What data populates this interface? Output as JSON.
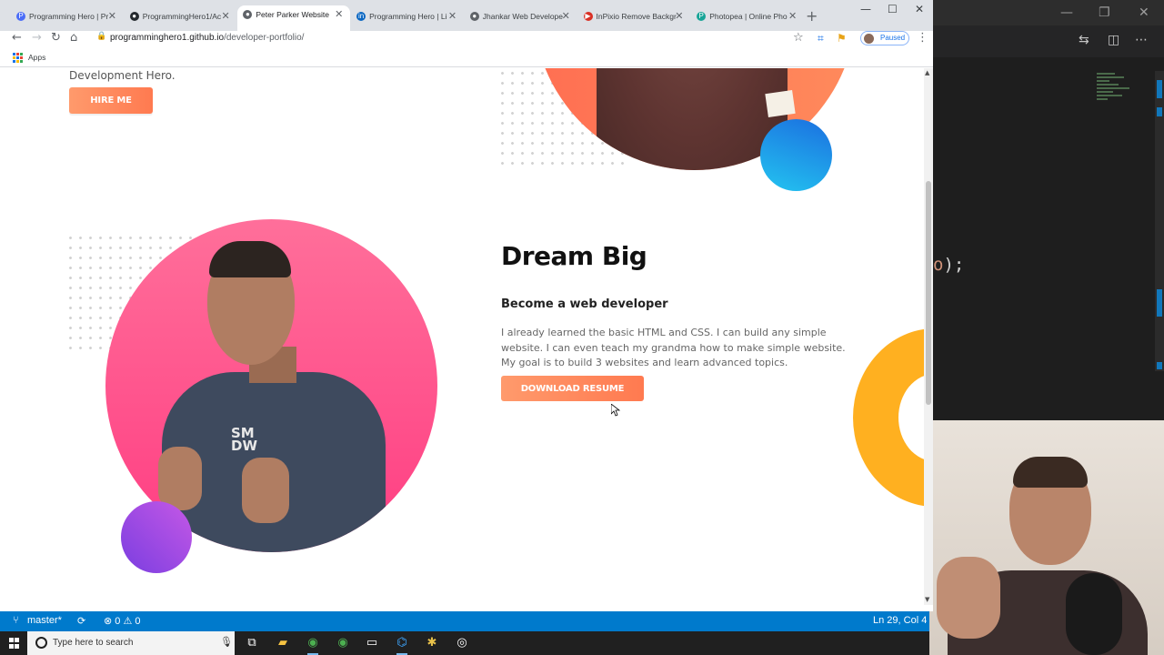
{
  "browser": {
    "tabs": [
      {
        "title": "Programming Hero | Pr",
        "favicon_color": "#4a6cf7",
        "favicon_glyph": "P"
      },
      {
        "title": "ProgrammingHero1/Ac",
        "favicon_color": "#24292e",
        "favicon_glyph": "●"
      },
      {
        "title": "Peter Parker Website",
        "favicon_color": "#5f6368",
        "favicon_glyph": "●"
      },
      {
        "title": "Programming Hero | Li",
        "favicon_color": "#0a66c2",
        "favicon_glyph": "in"
      },
      {
        "title": "Jhankar Web Develope",
        "favicon_color": "#5f6368",
        "favicon_glyph": "●"
      },
      {
        "title": "InPixio Remove Backgr",
        "favicon_color": "#d93025",
        "favicon_glyph": "▶"
      },
      {
        "title": "Photopea | Online Pho",
        "favicon_color": "#18a497",
        "favicon_glyph": "P"
      }
    ],
    "active_tab_index": 2,
    "url_host": "programminghero1.github.io",
    "url_path": "/developer-portfolio/",
    "profile_label": "Paused",
    "bookmarks_apps_label": "Apps"
  },
  "page": {
    "hero_tagline": "Development Hero.",
    "hire_button": "HIRE ME",
    "heading": "Dream Big",
    "subheading": "Become a web developer",
    "paragraph": "I already learned the basic HTML and CSS. I can build any simple website. I can even teach my grandma how to make simple website. My goal is to build 3 websites and learn advanced topics.",
    "resume_button": "DOWNLOAD RESUME",
    "tshirt_logo": "SM\nDW",
    "accent_color": "#ff7a50"
  },
  "vscode": {
    "branch": "master*",
    "errors": "0",
    "warnings": "0",
    "cursor_position": "Ln 29, Col 4",
    "code_fragment_paren": "o",
    "code_fragment_tail": ");"
  },
  "taskbar": {
    "search_placeholder": "Type here to search"
  }
}
